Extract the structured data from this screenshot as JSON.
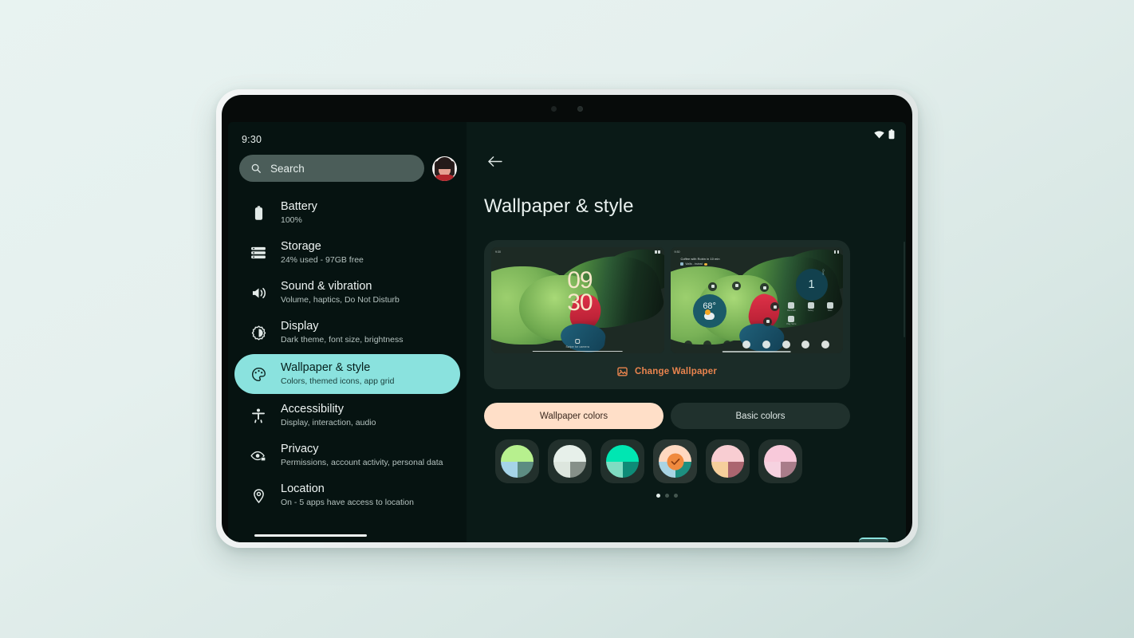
{
  "device": {
    "type": "android-tablet"
  },
  "statusbar": {
    "time": "9:30",
    "wifi_icon": "wifi-icon",
    "battery_icon": "battery-icon"
  },
  "sidebar": {
    "search": {
      "placeholder": "Search",
      "icon": "search-icon"
    },
    "avatar": {
      "name": "profile-avatar"
    },
    "items": [
      {
        "icon": "battery-icon",
        "title": "Battery",
        "subtitle": "100%",
        "selected": false
      },
      {
        "icon": "storage-icon",
        "title": "Storage",
        "subtitle": "24% used - 97GB free",
        "selected": false
      },
      {
        "icon": "sound-icon",
        "title": "Sound & vibration",
        "subtitle": "Volume, haptics, Do Not Disturb",
        "selected": false
      },
      {
        "icon": "display-icon",
        "title": "Display",
        "subtitle": "Dark theme, font size, brightness",
        "selected": false
      },
      {
        "icon": "palette-icon",
        "title": "Wallpaper & style",
        "subtitle": "Colors, themed icons, app grid",
        "selected": true
      },
      {
        "icon": "accessibility-icon",
        "title": "Accessibility",
        "subtitle": "Display, interaction, audio",
        "selected": false
      },
      {
        "icon": "privacy-eye-icon",
        "title": "Privacy",
        "subtitle": "Permissions, account activity, personal data",
        "selected": false
      },
      {
        "icon": "location-pin-icon",
        "title": "Location",
        "subtitle": "On - 5 apps have access to location",
        "selected": false
      }
    ]
  },
  "detail": {
    "back_icon": "back-arrow-icon",
    "title": "Wallpaper & style",
    "preview": {
      "lock": {
        "name": "lock-screen-preview",
        "clock_hours": "09",
        "clock_minutes": "30",
        "status_time": "9:30",
        "footer_text": "Swipe for camera"
      },
      "home": {
        "name": "home-screen-preview",
        "status_time": "9:30",
        "notification_title": "Coffee with Robin in 10 min",
        "notification_sub": "Wallis - Instead",
        "weather_temp": "68°",
        "clock_digit": "1",
        "clock_label": "Clock",
        "apps": [
          {
            "label": "Recorder"
          },
          {
            "label": "Safety"
          },
          {
            "label": "Files"
          },
          {
            "label": "Play Store"
          }
        ]
      }
    },
    "change_wallpaper": {
      "label": "Change Wallpaper",
      "icon": "image-icon"
    },
    "tabs": [
      {
        "label": "Wallpaper colors",
        "selected": true
      },
      {
        "label": "Basic colors",
        "selected": false
      }
    ],
    "swatches": [
      {
        "name": "color-swatch-1",
        "top": "#b7f08e",
        "bottom_left": "#a6d4e8",
        "bottom_right": "#5d8c82",
        "selected": false
      },
      {
        "name": "color-swatch-2",
        "top": "#e7f0ea",
        "bottom_left": "#dde6de",
        "bottom_right": "#869089",
        "selected": false
      },
      {
        "name": "color-swatch-3",
        "top": "#00e6b2",
        "bottom_left": "#7fdcc2",
        "bottom_right": "#0e8b77",
        "selected": false
      },
      {
        "name": "color-swatch-4",
        "top": "#ffd8c0",
        "bottom_left": "#a9d4e4",
        "bottom_right": "#1d8f80",
        "selected": true
      },
      {
        "name": "color-swatch-5",
        "top": "#f8cdd2",
        "bottom_left": "#f6cf9c",
        "bottom_right": "#ab6670",
        "selected": false
      },
      {
        "name": "color-swatch-6",
        "top": "#f8c9da",
        "bottom_left": "#f6d2e0",
        "bottom_right": "#a97d8a",
        "selected": false
      }
    ],
    "pager": {
      "count": 3,
      "active_index": 0
    }
  },
  "colors": {
    "page_background": "#e5f0ee",
    "screen_background": "#0a1a17",
    "sidebar_background": "#061311",
    "selected_item": "#8ae2de",
    "tab_selected": "#ffdfc8",
    "accent_orange": "#e9844e"
  }
}
